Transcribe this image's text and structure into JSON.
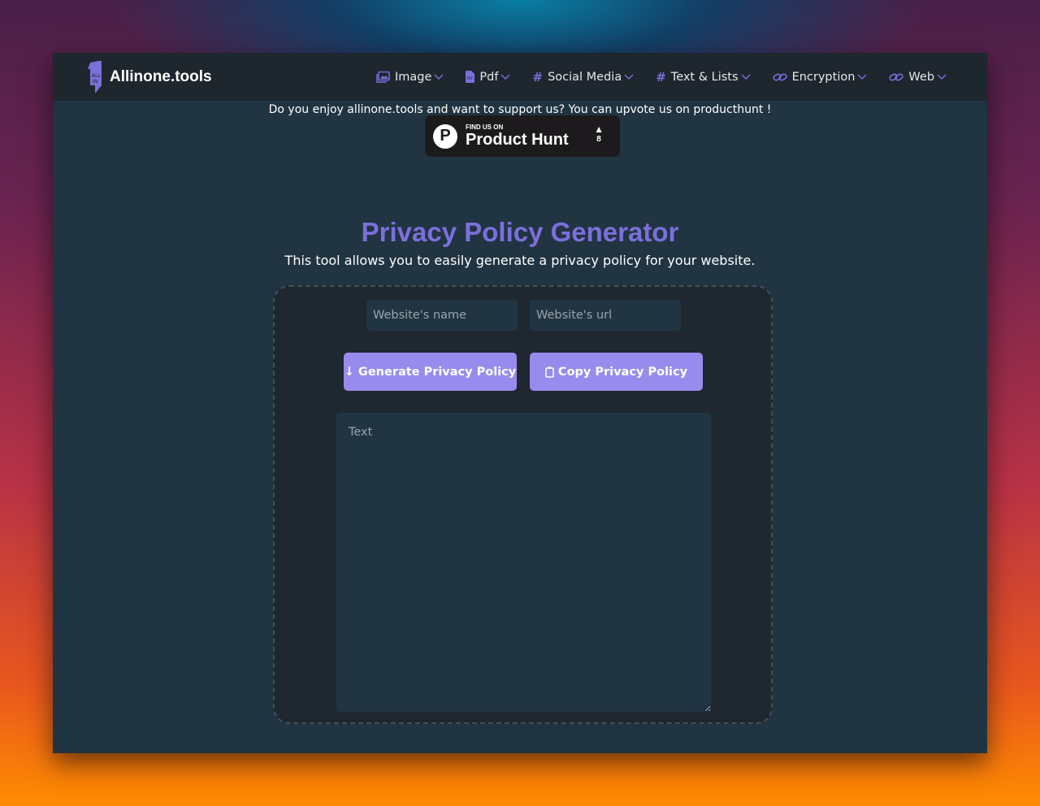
{
  "nav": {
    "brand": "Allinone.tools",
    "logo_text": "ALL IN",
    "items": [
      {
        "label": "Image",
        "icon": "image-icon"
      },
      {
        "label": "Pdf",
        "icon": "pdf-icon"
      },
      {
        "label": "Social Media",
        "icon": "hashtag-icon"
      },
      {
        "label": "Text & Lists",
        "icon": "hashtag-icon"
      },
      {
        "label": "Encryption",
        "icon": "link-icon"
      },
      {
        "label": "Web",
        "icon": "link-icon"
      }
    ]
  },
  "support": {
    "text": "Do you enjoy allinone.tools and want to support us? You can upvote us on producthunt !",
    "badge": {
      "small": "FIND US ON",
      "big": "Product Hunt",
      "votes": "8"
    }
  },
  "page": {
    "title": "Privacy Policy Generator",
    "subtitle": "This tool allows you to easily generate a privacy policy for your website."
  },
  "form": {
    "name_placeholder": "Website's name",
    "url_placeholder": "Website's url",
    "generate_label": "Generate Privacy Policy",
    "copy_label": "Copy Privacy Policy",
    "text_placeholder": "Text"
  },
  "colors": {
    "accent": "#7b70dc",
    "button": "#978ced",
    "nav_bg": "#1e262e",
    "page_bg": "#213442",
    "card_bg": "#1f2731"
  }
}
